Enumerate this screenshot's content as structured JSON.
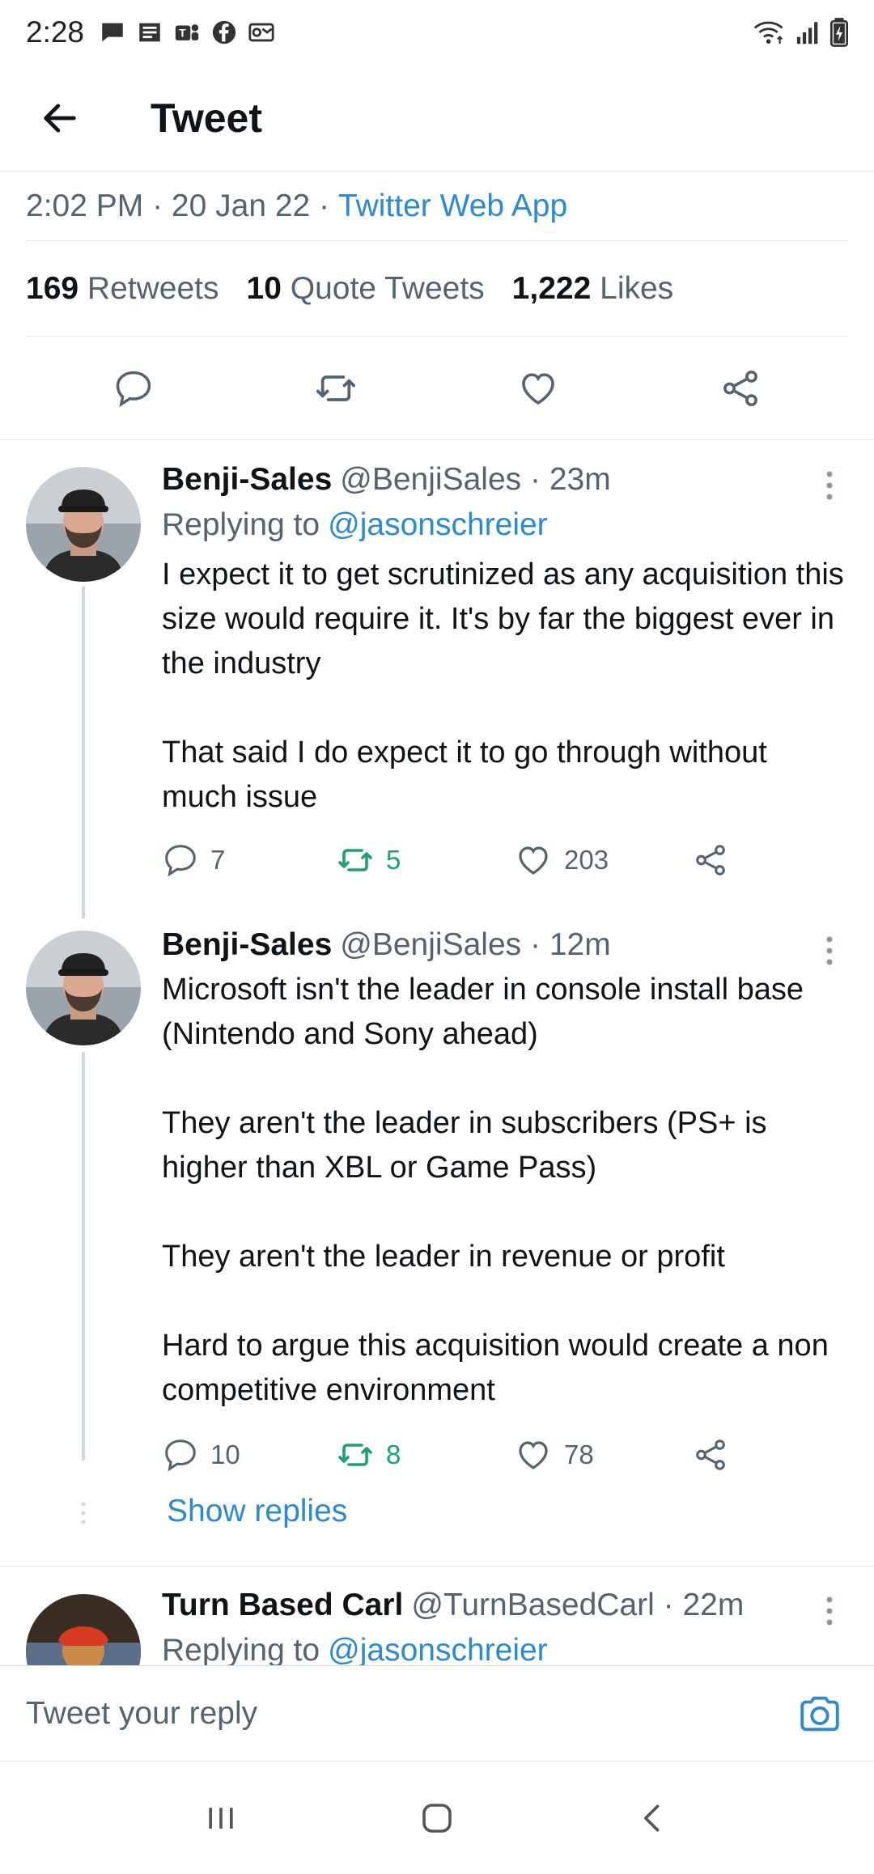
{
  "status_bar": {
    "time": "2:28"
  },
  "header": {
    "title": "Tweet"
  },
  "tweet": {
    "time": "2:02 PM",
    "date": "20 Jan 22",
    "source": "Twitter Web App",
    "retweets_count": "169",
    "retweets_label": "Retweets",
    "quotes_count": "10",
    "quotes_label": "Quote Tweets",
    "likes_count": "1,222",
    "likes_label": "Likes"
  },
  "replies": [
    {
      "name": "Benji-Sales",
      "handle": "@BenjiSales",
      "time": "23m",
      "replying_prefix": "Replying to",
      "replying_to": "@jasonschreier",
      "text": "I expect it to get scrutinized as any acquisition this size would require it. It's by far the biggest ever in the industry\n\nThat said I do expect it to go through without much issue",
      "reply_count": "7",
      "retweet_count": "5",
      "like_count": "203"
    },
    {
      "name": "Benji-Sales",
      "handle": "@BenjiSales",
      "time": "12m",
      "text": "Microsoft isn't the leader in console install base (Nintendo and Sony ahead)\n\nThey aren't the leader in subscribers (PS+ is higher than XBL or Game Pass)\n\nThey aren't the leader in revenue or profit\n\nHard to argue this acquisition would create a non competitive environment",
      "reply_count": "10",
      "retweet_count": "8",
      "like_count": "78"
    },
    {
      "name": "Turn Based Carl",
      "handle": "@TurnBasedCarl",
      "time": "22m",
      "replying_prefix": "Replying to",
      "replying_to": "@jasonschreier"
    }
  ],
  "show_replies_label": "Show replies",
  "reply_bar": {
    "placeholder": "Tweet your reply"
  },
  "colors": {
    "accent": "#2b8ad0",
    "retweet": "#1aa36e",
    "muted": "#536471"
  }
}
